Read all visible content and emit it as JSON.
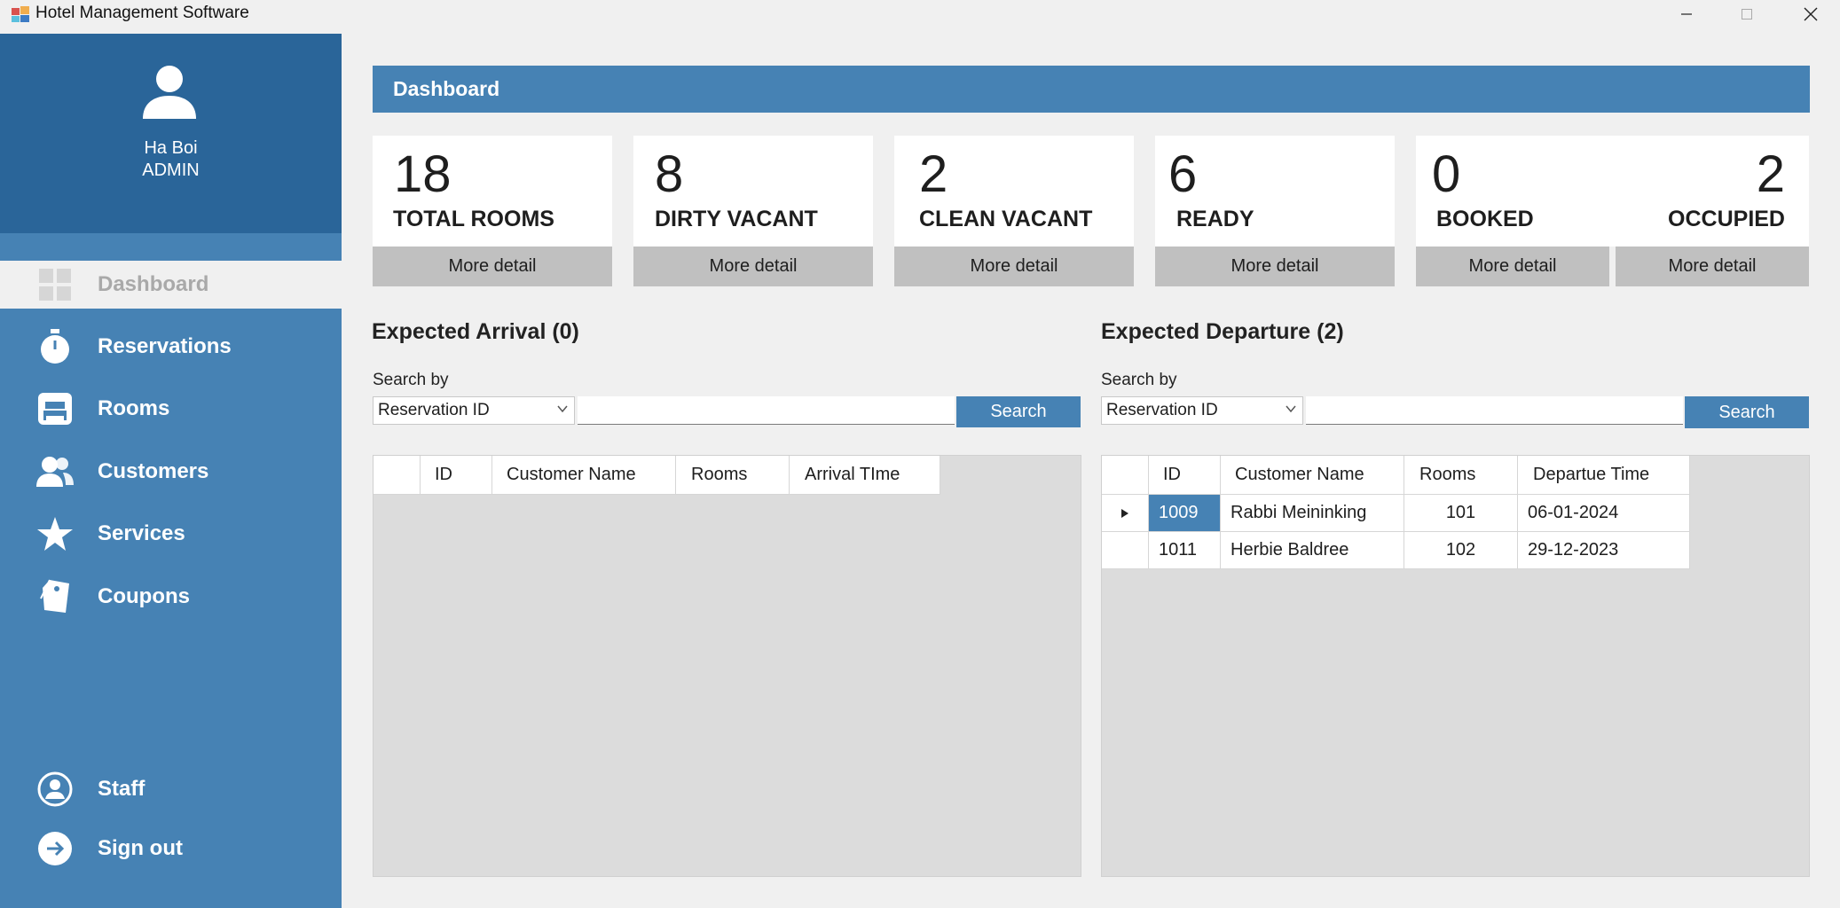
{
  "window": {
    "title": "Hotel Management Software"
  },
  "sidebar": {
    "user_name": "Ha Boi",
    "user_role": "ADMIN",
    "items": [
      {
        "label": "Dashboard",
        "icon": "dashboard-icon",
        "active": true
      },
      {
        "label": "Reservations",
        "icon": "stopwatch-icon"
      },
      {
        "label": "Rooms",
        "icon": "bed-icon"
      },
      {
        "label": "Customers",
        "icon": "users-icon"
      },
      {
        "label": "Services",
        "icon": "star-icon"
      },
      {
        "label": "Coupons",
        "icon": "tag-icon"
      },
      {
        "label": "Staff",
        "icon": "user-circle-icon"
      },
      {
        "label": "Sign out",
        "icon": "sign-out-icon"
      }
    ]
  },
  "header": {
    "title": "Dashboard"
  },
  "cards": [
    {
      "value": "18",
      "label": "TOTAL ROOMS",
      "button": "More detail"
    },
    {
      "value": "8",
      "label": "DIRTY VACANT",
      "button": "More detail"
    },
    {
      "value": "2",
      "label": "CLEAN VACANT",
      "button": "More detail"
    },
    {
      "value": "6",
      "label": "READY",
      "button": "More detail"
    },
    {
      "value": "0",
      "label": "BOOKED",
      "button": "More detail"
    },
    {
      "value": "2",
      "label": "OCCUPIED",
      "button": "More detail"
    }
  ],
  "arrival": {
    "title": "Expected Arrival (0)",
    "search_by": "Search by",
    "filter": "Reservation ID",
    "query": "",
    "search_button": "Search",
    "columns": [
      "ID",
      "Customer Name",
      "Rooms",
      "Arrival TIme"
    ],
    "rows": []
  },
  "departure": {
    "title": "Expected Departure (2)",
    "search_by": "Search by",
    "filter": "Reservation ID",
    "query": "",
    "search_button": "Search",
    "columns": [
      "ID",
      "Customer Name",
      "Rooms",
      "Departue Time"
    ],
    "rows": [
      {
        "id": "1009",
        "name": "Rabbi Meininking",
        "rooms": "101",
        "time": "06-01-2024"
      },
      {
        "id": "1011",
        "name": "Herbie Baldree",
        "rooms": "102",
        "time": "29-12-2023"
      }
    ]
  },
  "colors": {
    "accent": "#4682b4",
    "profile": "#2a6599",
    "button_gray": "#c0c0c0"
  }
}
